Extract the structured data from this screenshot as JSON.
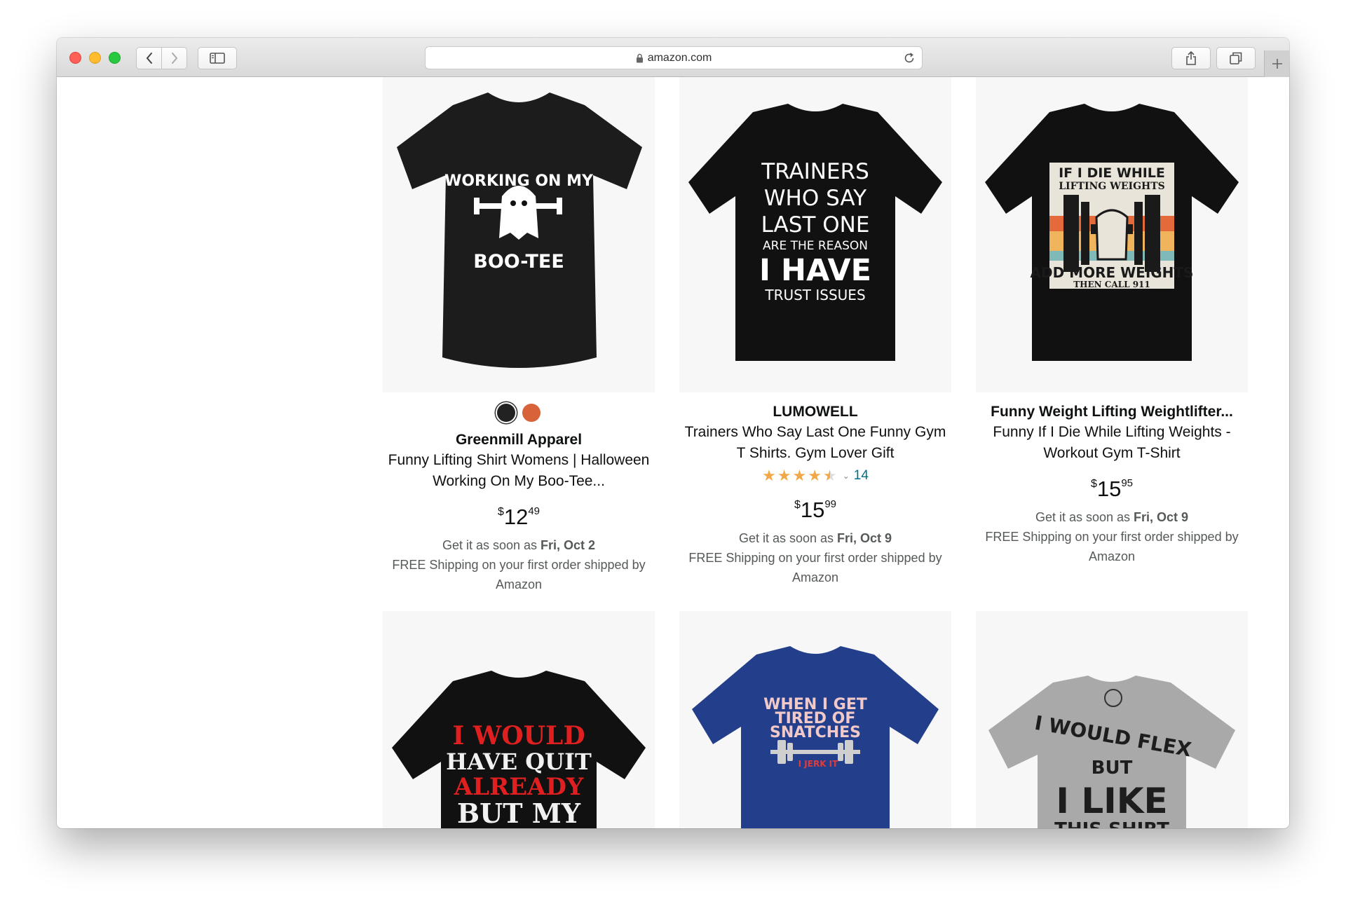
{
  "browser": {
    "url": "amazon.com",
    "icons": {
      "back": "chevron-left-icon",
      "forward": "chevron-right-icon",
      "sidebar": "sidebar-icon",
      "lock": "lock-icon",
      "reload": "reload-icon",
      "share": "share-icon",
      "tabs": "tabs-icon",
      "new_tab": "plus-icon"
    }
  },
  "products": [
    {
      "brand": "Greenmill Apparel",
      "title": "Funny Lifting Shirt Womens | Halloween Working On My Boo-Tee...",
      "price_dollars": "12",
      "price_cents": "49",
      "price_symbol": "$",
      "delivery_prefix": "Get it as soon as ",
      "delivery_date": "Fri, Oct 2",
      "shipping": "FREE Shipping on your first order shipped by Amazon",
      "swatches": [
        "#222222",
        "#d8623a"
      ],
      "shirt_text": [
        "WORKING ON MY",
        "BOO-TEE"
      ]
    },
    {
      "brand": "LUMOWELL",
      "title": "Trainers Who Say Last One Funny Gym T Shirts. Gym Lover Gift",
      "rating": 4.5,
      "review_count": "14",
      "price_dollars": "15",
      "price_cents": "99",
      "price_symbol": "$",
      "delivery_prefix": "Get it as soon as ",
      "delivery_date": "Fri, Oct 9",
      "shipping": "FREE Shipping on your first order shipped by Amazon",
      "shirt_text": [
        "TRAINERS",
        "WHO SAY",
        "LAST ONE",
        "ARE THE REASON",
        "I HAVE",
        "TRUST ISSUES"
      ]
    },
    {
      "brand": "Funny Weight Lifting Weightlifter...",
      "title": "Funny If I Die While Lifting Weights - Workout Gym T-Shirt",
      "price_dollars": "15",
      "price_cents": "95",
      "price_symbol": "$",
      "delivery_prefix": "Get it as soon as ",
      "delivery_date": "Fri, Oct 9",
      "shipping": "FREE Shipping on your first order shipped by Amazon",
      "shirt_text": [
        "IF I DIE WHILE",
        "LIFTING WEIGHTS",
        "ADD MORE WEIGHTS",
        "THEN CALL 911"
      ]
    }
  ],
  "row2": [
    {
      "shirt_text": [
        "I WOULD",
        "HAVE QUIT",
        "ALREADY",
        "BUT MY"
      ]
    },
    {
      "shirt_text": [
        "WHEN I GET",
        "TIRED OF",
        "SNATCHES",
        "I JERK IT"
      ]
    },
    {
      "shirt_text": [
        "I WOULD FLEX",
        "BUT",
        "I LIKE",
        "THIS SHIRT"
      ]
    }
  ]
}
